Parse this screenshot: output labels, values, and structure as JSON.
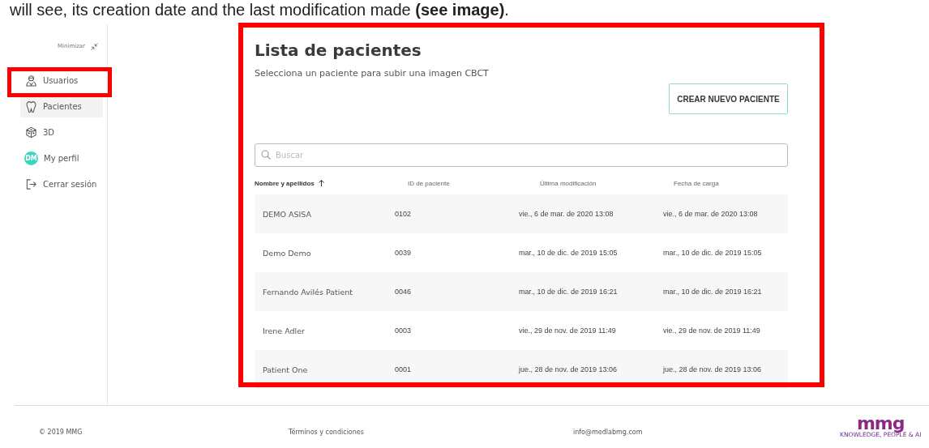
{
  "caption": "will see, its creation date and the last modification made **(see image)**.",
  "sidebar": {
    "minimize_label": "Minimizar",
    "items": [
      {
        "label": "Usuarios",
        "selected": false,
        "highlighted": true
      },
      {
        "label": "Pacientes",
        "selected": true,
        "highlighted": false
      },
      {
        "label": "3D",
        "selected": false,
        "highlighted": false
      },
      {
        "label": "My perfil",
        "initials": "DM",
        "selected": false,
        "highlighted": false
      },
      {
        "label": "Cerrar sesión",
        "selected": false,
        "highlighted": false
      }
    ]
  },
  "main": {
    "highlighted": true,
    "title": "Lista de pacientes",
    "subtitle": "Selecciona un paciente para subir una imagen CBCT",
    "button": "CREAR NUEVO PACIENTE",
    "search": {
      "placeholder": "Buscar"
    },
    "columns": [
      {
        "label": "Nombre y apellidos",
        "sorted": true
      },
      {
        "label": "ID de paciente",
        "sorted": false
      },
      {
        "label": "Última modificación",
        "sorted": false
      },
      {
        "label": "Fecha de carga",
        "sorted": false
      }
    ],
    "rows": [
      [
        "DEMO ASISA",
        "0102",
        "vie., 6 de mar. de 2020 13:08",
        "vie., 6 de mar. de 2020 13:08"
      ],
      [
        "Demo Demo",
        "0039",
        "mar., 10 de dic. de 2019 15:05",
        "mar., 10 de dic. de 2019 15:05"
      ],
      [
        "Fernando Avilés Patient",
        "0046",
        "mar., 10 de dic. de 2019 16:21",
        "mar., 10 de dic. de 2019 16:21"
      ],
      [
        "Irene Adler",
        "0003",
        "vie., 29 de nov. de 2019 11:49",
        "vie., 29 de nov. de 2019 11:49"
      ],
      [
        "Patient One",
        "0001",
        "jue., 28 de nov. de 2019 13:06",
        "jue., 28 de nov. de 2019 13:06"
      ]
    ]
  },
  "footer": {
    "copyright": "© 2019 MMG",
    "terms": "Términos y condiciones",
    "email": "info@medlabmg.com",
    "logo": {
      "text": "mmg",
      "tagline": "KNOWLEDGE, PEOPLE & AI"
    }
  }
}
